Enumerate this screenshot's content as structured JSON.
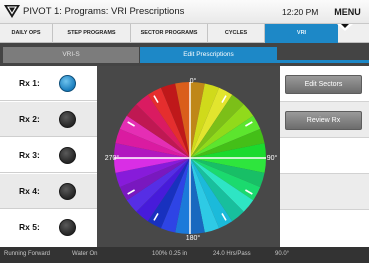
{
  "header": {
    "title": "PIVOT 1: Programs: VRI Prescriptions",
    "time": "12:20 PM",
    "menu_label": "MENU",
    "logo_icon": "pivot-logo-icon"
  },
  "nav": {
    "tabs": [
      {
        "label": "DAILY OPS",
        "active": false
      },
      {
        "label": "STEP PROGRAMS",
        "active": false
      },
      {
        "label": "SECTOR PROGRAMS",
        "active": false
      },
      {
        "label": "CYCLES",
        "active": false
      },
      {
        "label": "VRI",
        "active": true
      }
    ]
  },
  "subtabs": {
    "vri_s": "VRI-S",
    "edit_prescriptions": "Edit Prescriptions"
  },
  "prescriptions": [
    {
      "label": "Rx 1:",
      "selected": true
    },
    {
      "label": "Rx 2:",
      "selected": false
    },
    {
      "label": "Rx 3:",
      "selected": false
    },
    {
      "label": "Rx 4:",
      "selected": false
    },
    {
      "label": "Rx 5:",
      "selected": false
    }
  ],
  "wheel": {
    "labels": {
      "top": "0°",
      "right": "90°",
      "bottom": "180°",
      "left": "270°"
    },
    "colors": {
      "background": "#484848",
      "accent": "#1d88c7"
    }
  },
  "actions": {
    "edit_sectors": "Edit Sectors",
    "review_rx": "Review Rx"
  },
  "status": {
    "direction": "Running Forward",
    "water": "Water On",
    "rate": "100%  0.25 in",
    "pass_time": "24.0 Hrs/Pass",
    "angle": "90.0°"
  }
}
